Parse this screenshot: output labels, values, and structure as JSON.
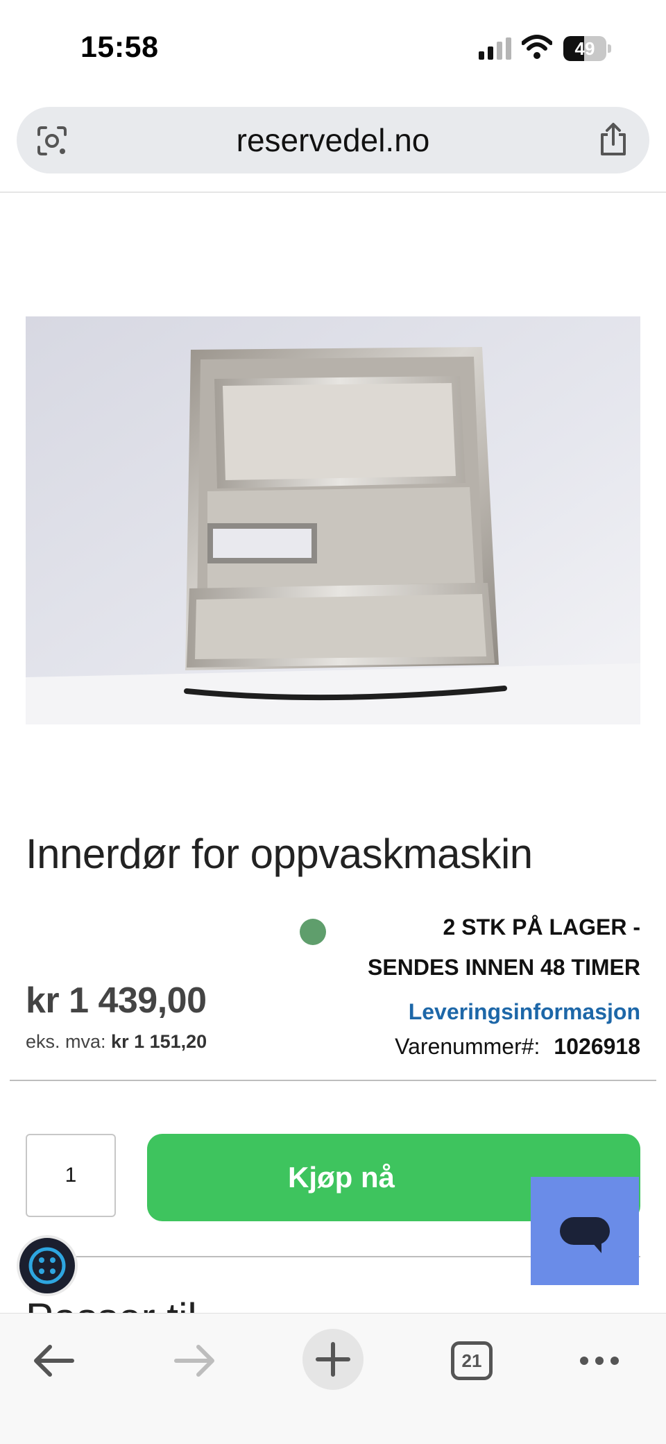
{
  "status_bar": {
    "time": "15:58",
    "battery_level": "49",
    "battery_fraction": 0.49
  },
  "browser": {
    "url": "reservedel.no",
    "tab_count": "21"
  },
  "product": {
    "title": "Innerdør for oppvaskmaskin",
    "price": "kr 1 439,00",
    "price_ex_vat_label": "eks. mva:",
    "price_ex_vat": "kr 1 151,20",
    "stock_line1": "2 STK PÅ LAGER -",
    "stock_line2": "SENDES INNEN 48 TIMER",
    "stock_color": "#5f9e6c",
    "delivery_link": "Leveringsinformasjon",
    "sku_label": "Varenummer#:",
    "sku_value": "1026918"
  },
  "purchase": {
    "quantity": "1",
    "buy_label": "Kjøp nå",
    "buy_color": "#3ec45e"
  },
  "partial_heading": "Passer til ...",
  "icons": {
    "address_left": "lens-icon",
    "address_right": "share-icon",
    "toolbar": [
      "back-arrow-icon",
      "forward-arrow-icon",
      "plus-icon",
      "tabs-icon",
      "more-icon"
    ],
    "chat": "chat-bubble-icon",
    "cookie": "cookie-settings-icon"
  }
}
